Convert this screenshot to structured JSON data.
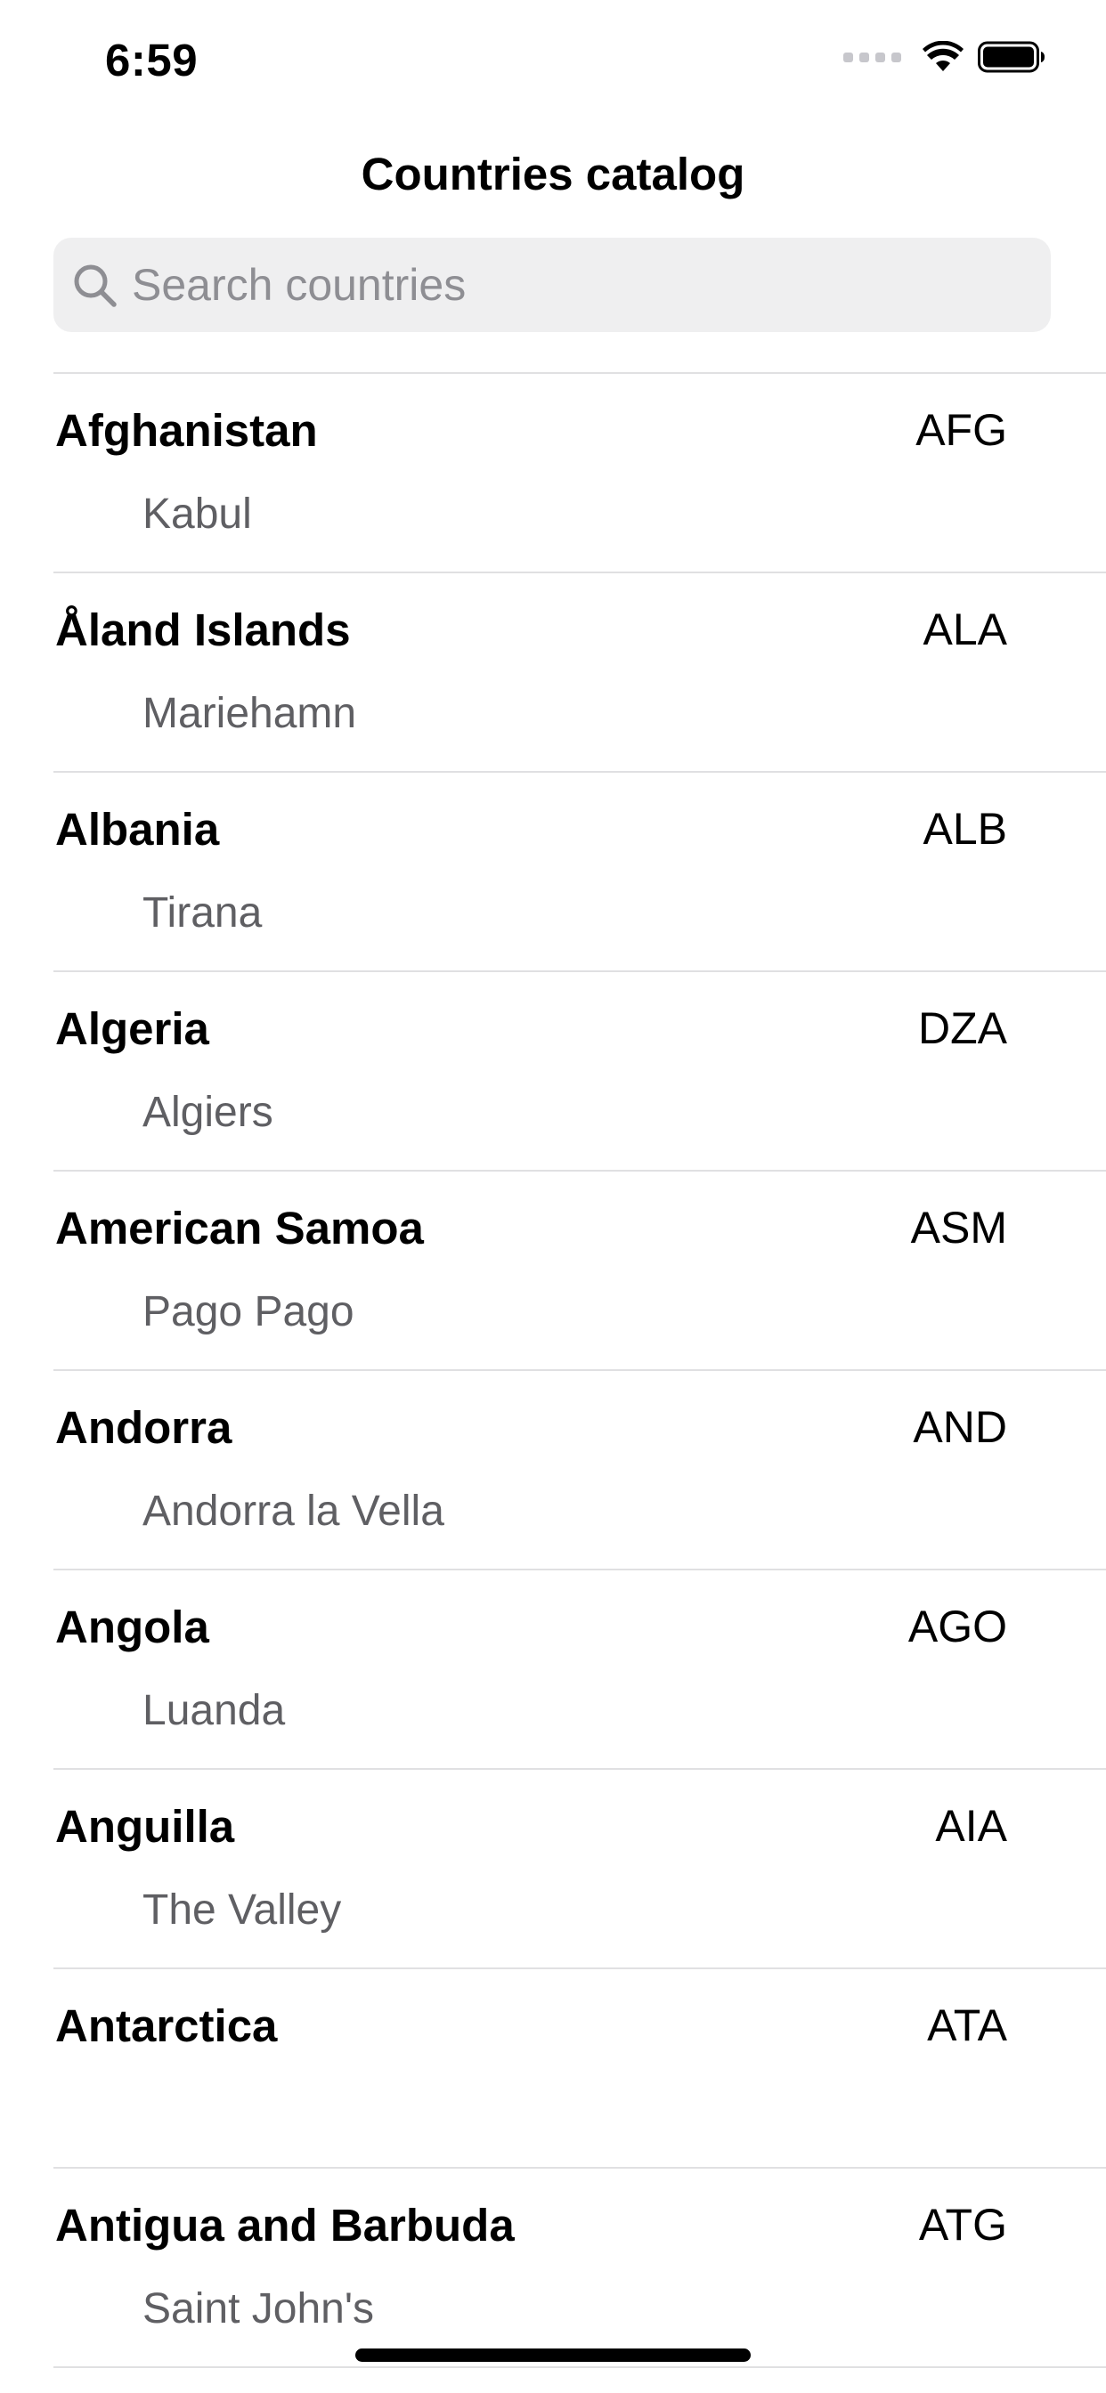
{
  "status_bar": {
    "time": "6:59"
  },
  "header": {
    "title": "Countries catalog"
  },
  "search": {
    "placeholder": "Search countries",
    "value": ""
  },
  "countries": [
    {
      "name": "Afghanistan",
      "code": "AFG",
      "capital": "Kabul"
    },
    {
      "name": "Åland Islands",
      "code": "ALA",
      "capital": "Mariehamn"
    },
    {
      "name": "Albania",
      "code": "ALB",
      "capital": "Tirana"
    },
    {
      "name": "Algeria",
      "code": "DZA",
      "capital": "Algiers"
    },
    {
      "name": "American Samoa",
      "code": "ASM",
      "capital": "Pago Pago"
    },
    {
      "name": "Andorra",
      "code": "AND",
      "capital": "Andorra la Vella"
    },
    {
      "name": "Angola",
      "code": "AGO",
      "capital": "Luanda"
    },
    {
      "name": "Anguilla",
      "code": "AIA",
      "capital": "The Valley"
    },
    {
      "name": "Antarctica",
      "code": "ATA",
      "capital": ""
    },
    {
      "name": "Antigua and Barbuda",
      "code": "ATG",
      "capital": "Saint John's"
    }
  ],
  "icons": {
    "search": "search-icon",
    "wifi": "wifi-icon",
    "battery": "battery-icon",
    "signal": "cellular-signal-icon"
  }
}
